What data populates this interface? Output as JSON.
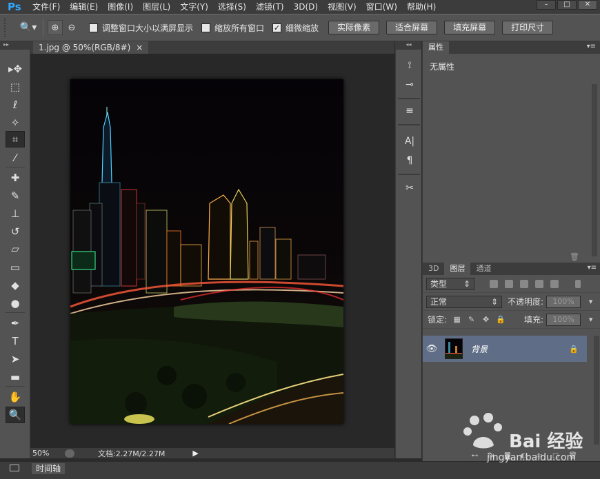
{
  "app": {
    "logo": "Ps"
  },
  "menu": [
    "文件(F)",
    "编辑(E)",
    "图像(I)",
    "图层(L)",
    "文字(Y)",
    "选择(S)",
    "滤镜(T)",
    "3D(D)",
    "视图(V)",
    "窗口(W)",
    "帮助(H)"
  ],
  "options": {
    "chk_resize": "调整窗口大小以满屏显示",
    "chk_all": "缩放所有窗口",
    "chk_scrubby": "细微缩放",
    "btn_actual": "实际像素",
    "btn_fit": "适合屏幕",
    "btn_fill": "填充屏幕",
    "btn_print": "打印尺寸"
  },
  "document": {
    "tab_title": "1.jpg @ 50%(RGB/8#)",
    "tab_close": "×",
    "zoom": "50%",
    "doc_info": "文档:2.27M/2.27M"
  },
  "timeline": {
    "tab": "时间轴"
  },
  "properties": {
    "tab": "属性",
    "empty_text": "无属性"
  },
  "layers": {
    "tabs": [
      "3D",
      "图层",
      "通道"
    ],
    "filter_kind": "类型",
    "blend_mode": "正常",
    "opacity_label": "不透明度:",
    "opacity_value": "100%",
    "lock_label": "锁定:",
    "fill_label": "填充:",
    "fill_value": "100%",
    "layer_name": "背景"
  },
  "watermark": {
    "brand": "Bai  经验",
    "url": "jingyan.baidu.com"
  },
  "colors": {
    "accent": "#31a8ff",
    "selected_layer": "#5f6e86",
    "panel": "#535353",
    "dark": "#3c3c3c"
  }
}
